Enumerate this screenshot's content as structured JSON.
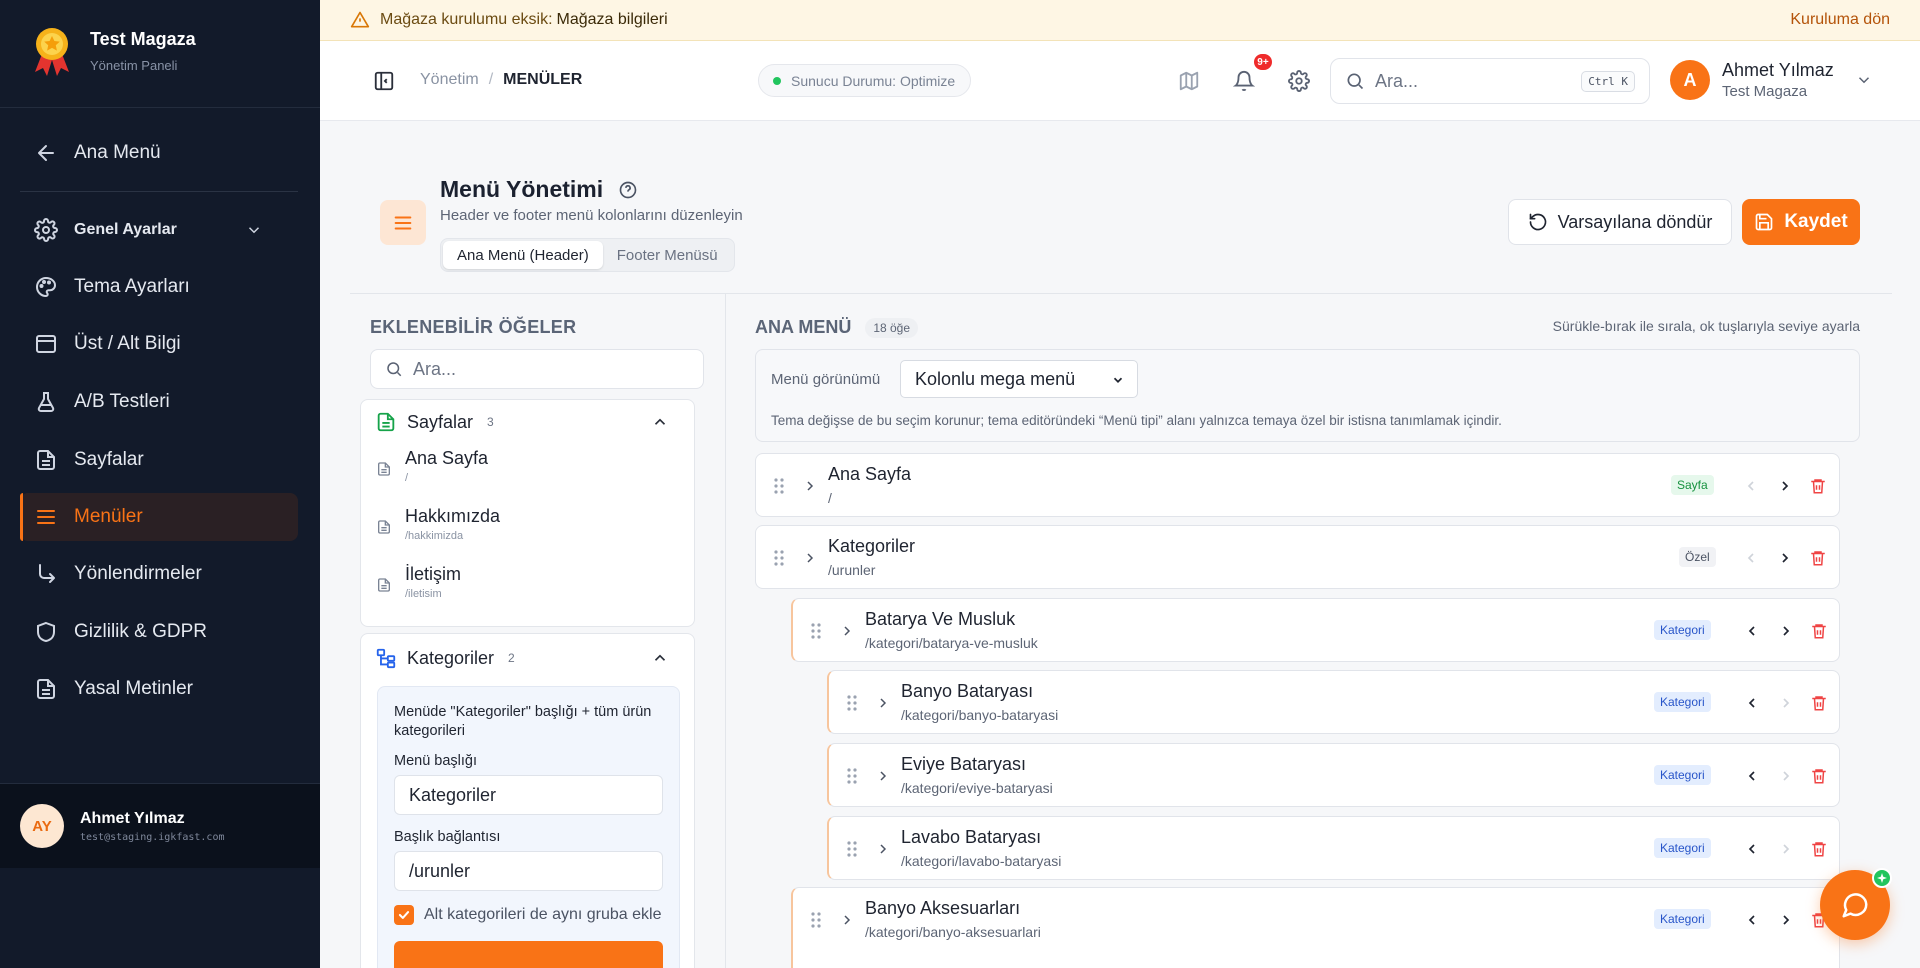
{
  "sidebar": {
    "brand_title": "Test Magaza",
    "brand_subtitle": "Yönetim Paneli",
    "items": [
      {
        "label": "Ana Menü",
        "icon": "arrow-left-icon"
      },
      {
        "label": "Genel Ayarlar",
        "icon": "gear-icon"
      },
      {
        "label": "Tema Ayarları",
        "icon": "palette-icon"
      },
      {
        "label": "Üst / Alt Bilgi",
        "icon": "layout-icon"
      },
      {
        "label": "A/B Testleri",
        "icon": "flask-icon"
      },
      {
        "label": "Sayfalar",
        "icon": "file-icon"
      },
      {
        "label": "Menüler",
        "icon": "menu-icon",
        "active": true
      },
      {
        "label": "Yönlendirmeler",
        "icon": "redirect-arrow-icon"
      },
      {
        "label": "Gizlilik & GDPR",
        "icon": "shield-icon"
      },
      {
        "label": "Yasal Metinler",
        "icon": "file-icon"
      }
    ],
    "user": {
      "initials": "AY",
      "name": "Ahmet Yılmaz",
      "email": "test@staging.igkfast.com"
    }
  },
  "banner": {
    "text": "Mağaza kurulumu eksik:",
    "highlight": "Mağaza bilgileri",
    "link": "Kuruluma dön"
  },
  "header": {
    "breadcrumb_root": "Yönetim",
    "breadcrumb_current": "MENÜLER",
    "server_status": "Sunucu Durumu: Optimize",
    "notif_badge": "9+",
    "search_placeholder": "Ara...",
    "search_shortcut": "Ctrl K",
    "user_initial": "A",
    "user_name": "Ahmet Yılmaz",
    "user_company": "Test Magaza"
  },
  "page": {
    "title": "Menü Yönetimi",
    "subtitle": "Header ve footer menü kolonlarını düzenleyin",
    "tabs": [
      "Ana Menü (Header)",
      "Footer Menüsü"
    ],
    "reset_label": "Varsayılana döndür",
    "save_label": "Kaydet"
  },
  "available": {
    "heading": "EKLENEBİLİR ÖĞELER",
    "search_placeholder": "Ara...",
    "pages_group": {
      "title": "Sayfalar",
      "count": "3",
      "items": [
        {
          "name": "Ana Sayfa",
          "url": "/"
        },
        {
          "name": "Hakkımızda",
          "url": "/hakkimizda"
        },
        {
          "name": "İletişim",
          "url": "/iletisim"
        }
      ]
    },
    "categories_group": {
      "title": "Kategoriler",
      "count": "2",
      "description": "Menüde \"Kategoriler\" başlığı + tüm ürün kategorileri",
      "title_label": "Menü başlığı",
      "title_value": "Kategoriler",
      "link_label": "Başlık bağlantısı",
      "link_value": "/urunler",
      "checkbox_label": "Alt kategorileri de aynı gruba ekle"
    }
  },
  "menu": {
    "heading": "ANA MENÜ",
    "count_label": "18 öğe",
    "hint": "Sürükle-bırak ile sırala, ok tuşlarıyla seviye ayarla",
    "view_label": "Menü görünümü",
    "view_value": "Kolonlu mega menü",
    "view_note": "Tema değişse de bu seçim korunur; tema editöründeki “Menü tipi” alanı yalnızca temaya özel bir istisna tanımlamak içindir.",
    "items": [
      {
        "name": "Ana Sayfa",
        "url": "/",
        "tag": "Sayfa",
        "level": 0
      },
      {
        "name": "Kategoriler",
        "url": "/urunler",
        "tag": "Özel",
        "level": 0
      },
      {
        "name": "Batarya Ve Musluk",
        "url": "/kategori/batarya-ve-musluk",
        "tag": "Kategori",
        "level": 1
      },
      {
        "name": "Banyo Bataryası",
        "url": "/kategori/banyo-bataryasi",
        "tag": "Kategori",
        "level": 2
      },
      {
        "name": "Eviye Bataryası",
        "url": "/kategori/eviye-bataryasi",
        "tag": "Kategori",
        "level": 2
      },
      {
        "name": "Lavabo Bataryası",
        "url": "/kategori/lavabo-bataryasi",
        "tag": "Kategori",
        "level": 2
      },
      {
        "name": "Banyo Aksesuarları",
        "url": "/kategori/banyo-aksesuarlari",
        "tag": "Kategori",
        "level": 1
      }
    ]
  },
  "colors": {
    "accent": "#f97316",
    "sidebar": "#121a2a",
    "banner": "#fef6e4",
    "danger": "#ef4444"
  }
}
